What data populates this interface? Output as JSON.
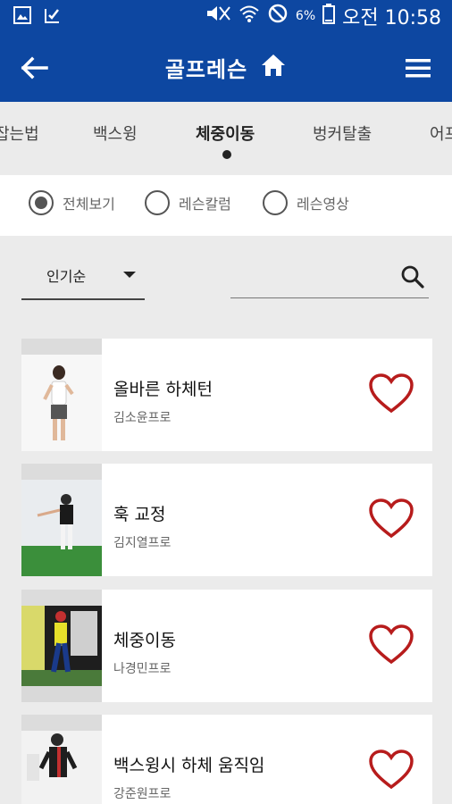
{
  "status_bar": {
    "battery_percent": "6%",
    "time": "오전 10:58",
    "icons": [
      "gallery-icon",
      "check-icon",
      "mute-icon",
      "wifi-icon",
      "no-sim-icon",
      "battery-icon"
    ]
  },
  "header": {
    "title": "골프레슨",
    "icons": [
      "back-arrow-icon",
      "home-icon",
      "menu-icon"
    ]
  },
  "tabs": [
    {
      "label": "잡는법",
      "active": false
    },
    {
      "label": "백스윙",
      "active": false
    },
    {
      "label": "체중이동",
      "active": true
    },
    {
      "label": "벙커탈출",
      "active": false
    },
    {
      "label": "어프",
      "active": false
    }
  ],
  "filter": {
    "options": [
      {
        "label": "전체보기",
        "checked": true
      },
      {
        "label": "레슨칼럼",
        "checked": false
      },
      {
        "label": "레슨영상",
        "checked": false
      }
    ]
  },
  "sort": {
    "selected": "인기순"
  },
  "search": {
    "value": "",
    "placeholder": ""
  },
  "lessons": [
    {
      "title": "올바른 하체턴",
      "instructor": "김소윤프로",
      "favorite": false
    },
    {
      "title": "훅 교정",
      "instructor": "김지열프로",
      "favorite": false
    },
    {
      "title": "체중이동",
      "instructor": "나경민프로",
      "favorite": false
    },
    {
      "title": "백스윙시 하체 움직임",
      "instructor": "강준원프로",
      "favorite": false
    }
  ],
  "colors": {
    "primary": "#0d47a1",
    "heart": "#b71c1c",
    "background": "#ebebeb"
  }
}
